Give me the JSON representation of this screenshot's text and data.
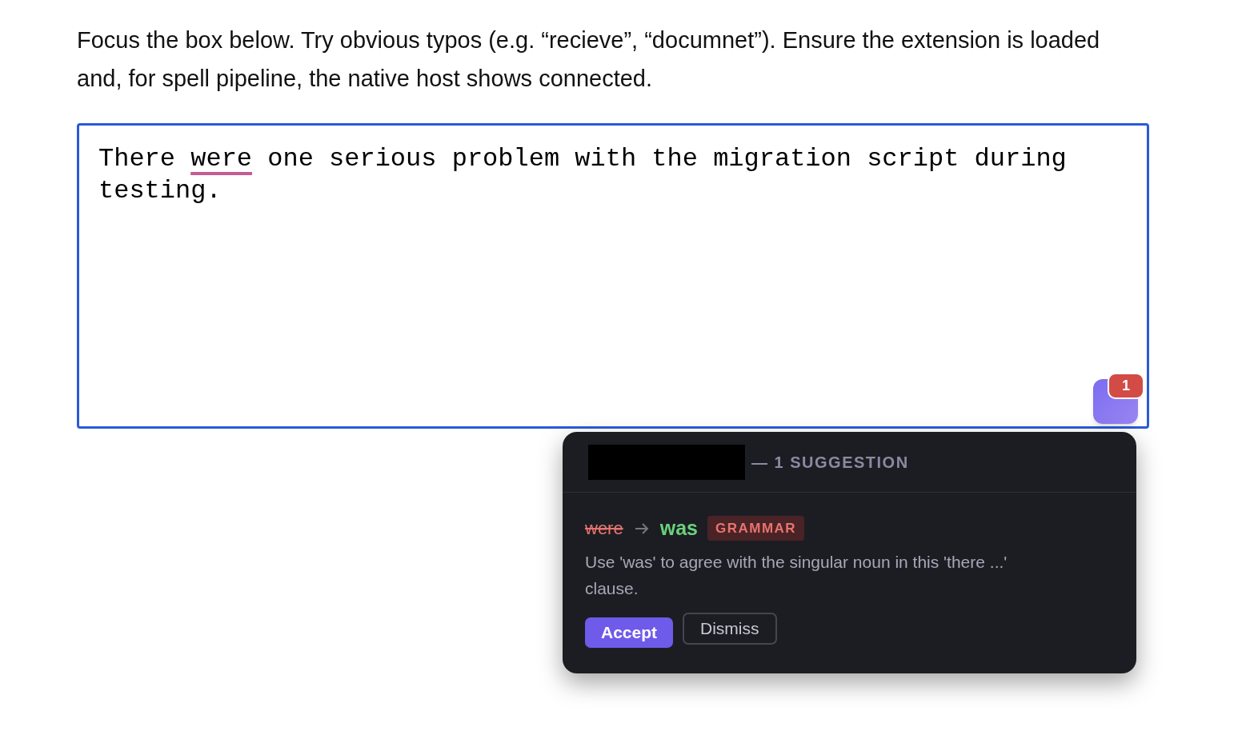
{
  "instructions": "Focus the box below. Try obvious typos (e.g. “recieve”, “documnet”). Ensure the extension is loaded and, for spell pipeline, the native host shows connected.",
  "editor": {
    "focused": true,
    "segments": [
      {
        "text": "There ",
        "flagged": false
      },
      {
        "text": "were",
        "flagged": true
      },
      {
        "text": " one serious problem with the migration script during testing.",
        "flagged": false
      }
    ]
  },
  "launcher": {
    "badge": "1"
  },
  "popup": {
    "header": "— 1 SUGGESTION",
    "redacted": true,
    "suggestions": [
      {
        "original": "were",
        "replacement": "was",
        "category": "GRAMMAR",
        "message": "Use 'was' to agree with the singular noun in this 'there ...' clause.",
        "actions": [
          {
            "label": "Accept",
            "kind": "primary"
          },
          {
            "label": "Dismiss",
            "kind": "secondary"
          }
        ]
      }
    ]
  }
}
